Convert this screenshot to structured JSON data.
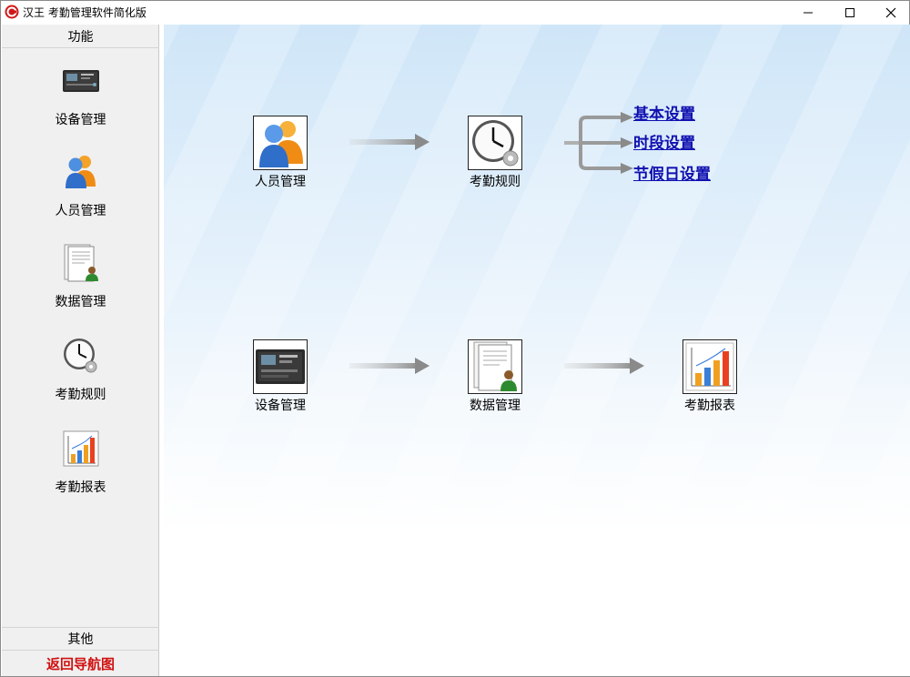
{
  "window": {
    "title": "汉王 考勤管理软件简化版"
  },
  "sidebar": {
    "header": "功能",
    "items": [
      {
        "label": "设备管理",
        "icon": "device-icon"
      },
      {
        "label": "人员管理",
        "icon": "people-icon"
      },
      {
        "label": "数据管理",
        "icon": "data-document-icon"
      },
      {
        "label": "考勤规则",
        "icon": "clock-icon"
      },
      {
        "label": "考勤报表",
        "icon": "report-chart-icon"
      }
    ],
    "other": "其他",
    "return_nav": "返回导航图"
  },
  "flow": {
    "row1": {
      "node1": "人员管理",
      "node2": "考勤规则"
    },
    "links": [
      "基本设置",
      "时段设置",
      "节假日设置"
    ],
    "row2": {
      "node1": "设备管理",
      "node2": "数据管理",
      "node3": "考勤报表"
    }
  },
  "colors": {
    "return_nav": "#d01010",
    "link": "#1010b0",
    "accent_orange": "#f29a1d",
    "accent_blue": "#3a7fd8"
  }
}
